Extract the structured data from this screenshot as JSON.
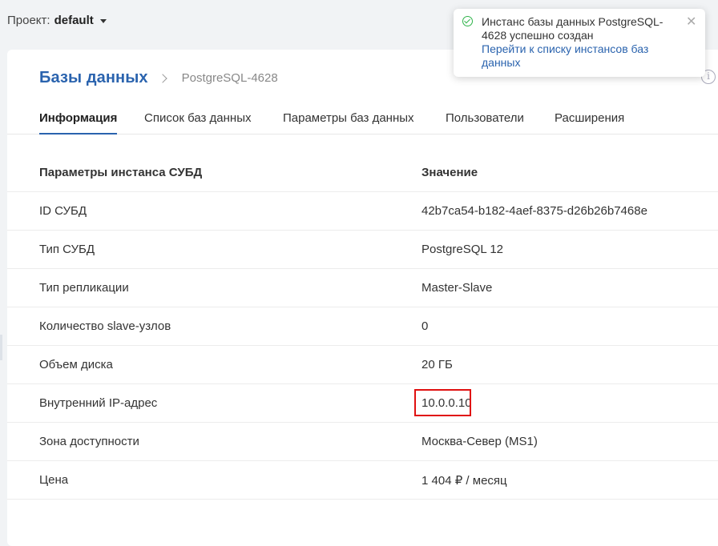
{
  "project": {
    "label": "Проект:",
    "value": "default"
  },
  "breadcrumb": {
    "root": "Базы данных",
    "current": "PostgreSQL-4628"
  },
  "tabs": [
    {
      "label": "Информация",
      "active": true
    },
    {
      "label": "Список баз данных"
    },
    {
      "label": "Параметры баз данных"
    },
    {
      "label": "Пользователи"
    },
    {
      "label": "Расширения"
    }
  ],
  "table": {
    "headers": [
      "Параметры инстанса СУБД",
      "Значение"
    ],
    "rows": [
      [
        "ID СУБД",
        "42b7ca54-b182-4aef-8375-d26b26b7468e"
      ],
      [
        "Тип СУБД",
        "PostgreSQL 12"
      ],
      [
        "Тип репликации",
        "Master-Slave"
      ],
      [
        "Количество slave-узлов",
        "0"
      ],
      [
        "Объем диска",
        "20 ГБ"
      ],
      [
        "Внутренний IP-адрес",
        "10.0.0.10"
      ],
      [
        "Зона доступности",
        "Москва-Север (MS1)"
      ],
      [
        "Цена",
        "1 404 ₽ / месяц"
      ]
    ]
  },
  "toast": {
    "message": "Инстанс базы данных PostgreSQL-4628 успешно создан",
    "link": "Перейти к списку инстансов баз данных",
    "close": "✕"
  },
  "icons": {
    "info": "i"
  },
  "colors": {
    "accent": "#2a63ae",
    "success": "#2fb34a",
    "highlight": "#e01010"
  }
}
